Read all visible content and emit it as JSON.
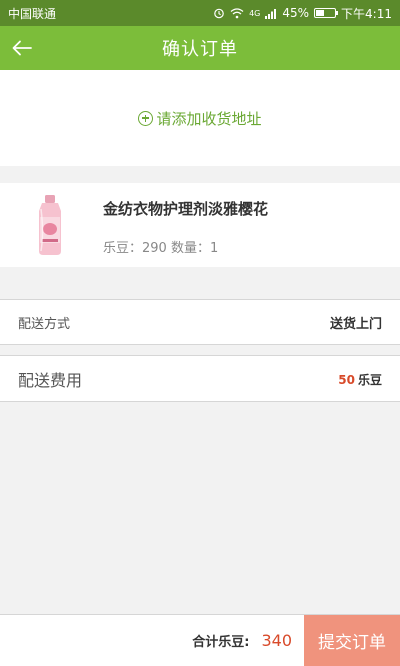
{
  "status_bar": {
    "carrier": "中国联通",
    "signal": "4G",
    "battery": "45%",
    "battery_level": 0.45,
    "time": "下午4:11"
  },
  "nav": {
    "back_icon": "arrow-left-icon",
    "title": "确认订单"
  },
  "address": {
    "icon": "plus-circle-icon",
    "label": "请添加收货地址"
  },
  "product": {
    "name": "金纺衣物护理剂淡雅樱花",
    "price_label": "乐豆：290",
    "quantity_label": "数量：1"
  },
  "delivery": {
    "label": "配送方式",
    "value": "送货上门"
  },
  "fee": {
    "label": "配送费用",
    "amount": "50",
    "unit": "乐豆"
  },
  "footer": {
    "total_label": "合计乐豆:",
    "total_value": "340",
    "submit_label": "提交订单"
  },
  "colors": {
    "status_bar": "#5b8a2b",
    "nav_bar": "#7cbd3a",
    "accent_green": "#6aa833",
    "price_red": "#d84a2a",
    "submit_button": "#f0937d"
  }
}
